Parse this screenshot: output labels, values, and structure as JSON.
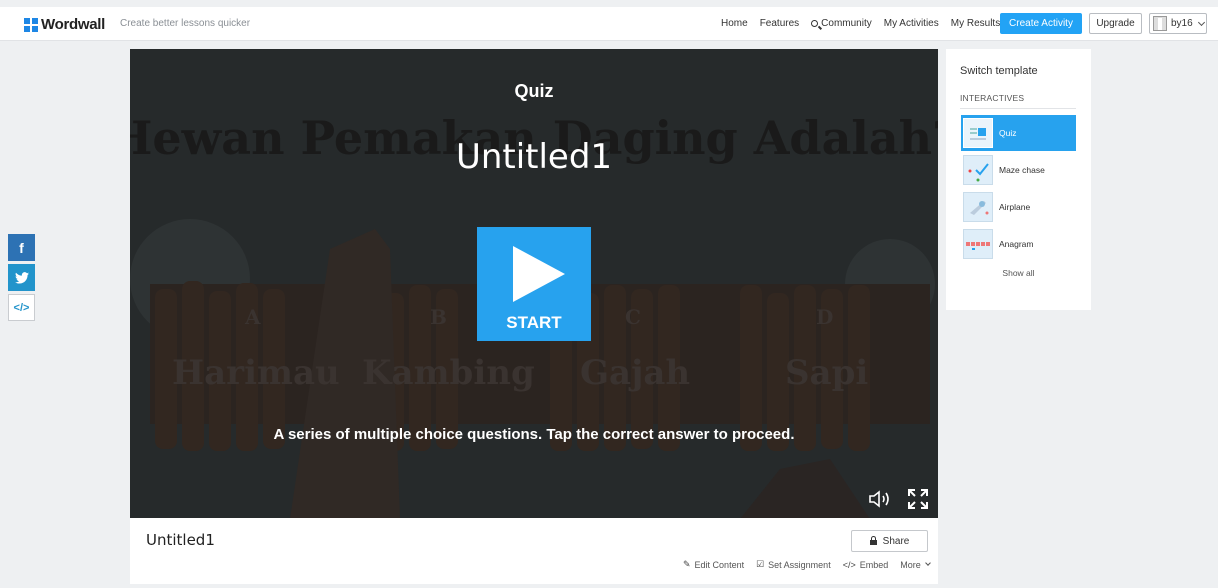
{
  "header": {
    "logo_text": "Wordwall",
    "tagline": "Create better lessons quicker",
    "nav": [
      "Home",
      "Features",
      "Community",
      "My Activities",
      "My Results"
    ],
    "create_label": "Create Activity",
    "upgrade_label": "Upgrade",
    "username": "by16"
  },
  "game": {
    "type": "Quiz",
    "title": "Untitled1",
    "start_label": "START",
    "description": "A series of multiple choice questions. Tap the correct answer to proceed.",
    "background_question": "Hewan Pemakan Daging Adalah?",
    "background_answers": [
      {
        "letter": "A",
        "text": "Harimau"
      },
      {
        "letter": "B",
        "text": "Kambing"
      },
      {
        "letter": "C",
        "text": "Gajah"
      },
      {
        "letter": "D",
        "text": "Sapi"
      }
    ]
  },
  "info": {
    "title": "Untitled1",
    "share_label": "Share",
    "actions": [
      "Edit Content",
      "Set Assignment",
      "Embed",
      "More"
    ]
  },
  "templates": {
    "heading": "Switch template",
    "section": "INTERACTIVES",
    "items": [
      "Quiz",
      "Maze chase",
      "Airplane",
      "Anagram"
    ],
    "active": "Quiz",
    "show_all": "Show all"
  },
  "colors": {
    "accent": "#27a2ee",
    "facebook": "#2d72b4",
    "twitter": "#2294cb",
    "game_bg": "#262a2b"
  },
  "icons": [
    "search-icon",
    "facebook-icon",
    "twitter-icon",
    "embed-icon",
    "play-icon",
    "sound-icon",
    "fullscreen-icon",
    "lock-icon",
    "pencil-icon",
    "checkbox-icon",
    "code-icon",
    "chevron-down-icon"
  ]
}
